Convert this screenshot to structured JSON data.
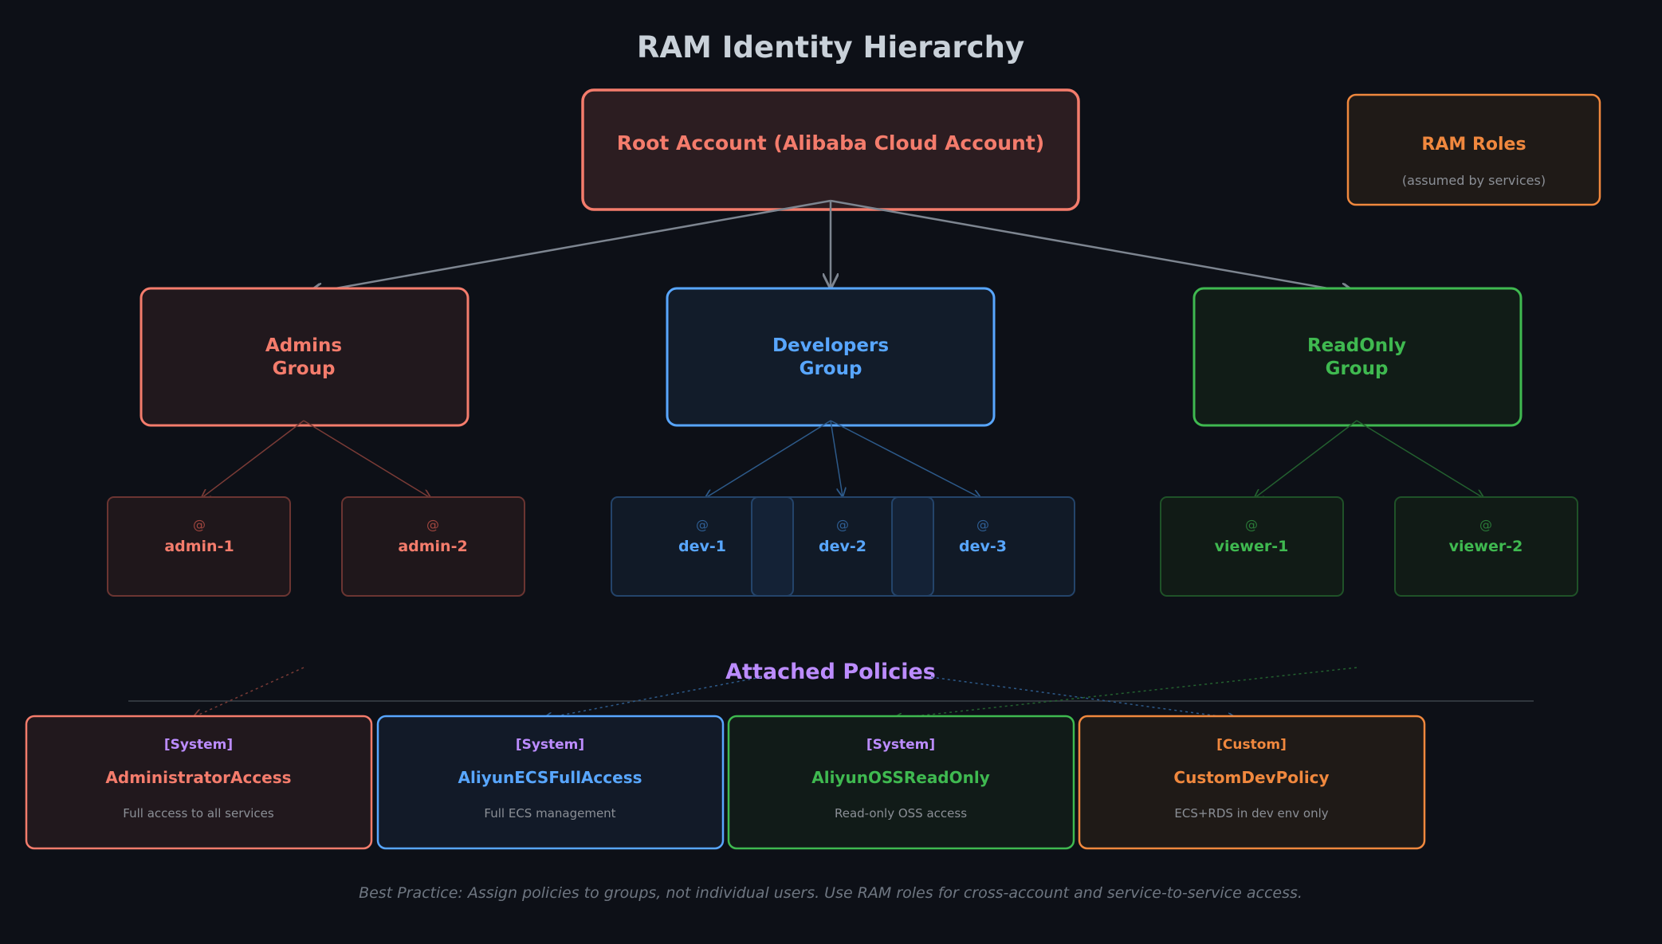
{
  "title": "RAM Identity Hierarchy",
  "root": {
    "label": "Root Account (Alibaba Cloud Account)"
  },
  "roles": {
    "label": "RAM Roles",
    "sublabel": "(assumed by services)"
  },
  "groups": [
    {
      "line1": "Admins",
      "line2": "Group",
      "color": "#f47c6c"
    },
    {
      "line1": "Developers",
      "line2": "Group",
      "color": "#58a6ff"
    },
    {
      "line1": "ReadOnly",
      "line2": "Group",
      "color": "#3fb950"
    }
  ],
  "user_icon": "@",
  "users": [
    {
      "name": "admin-1"
    },
    {
      "name": "admin-2"
    },
    {
      "name": "dev-1"
    },
    {
      "name": "dev-2"
    },
    {
      "name": "dev-3"
    },
    {
      "name": "viewer-1"
    },
    {
      "name": "viewer-2"
    }
  ],
  "policies_heading": "Attached Policies",
  "policies": [
    {
      "tag": "[System]",
      "name": "AdministratorAccess",
      "desc": "Full access to all services",
      "color": "#f47c6c"
    },
    {
      "tag": "[System]",
      "name": "AliyunECSFullAccess",
      "desc": "Full ECS management",
      "color": "#58a6ff"
    },
    {
      "tag": "[System]",
      "name": "AliyunOSSReadOnly",
      "desc": "Read-only OSS access",
      "color": "#3fb950"
    },
    {
      "tag": "[Custom]",
      "name": "CustomDevPolicy",
      "desc": "ECS+RDS in dev env only",
      "color": "#f0883e"
    }
  ],
  "footer": "Best Practice: Assign policies to groups, not individual users. Use RAM roles for cross-account and service-to-service access."
}
